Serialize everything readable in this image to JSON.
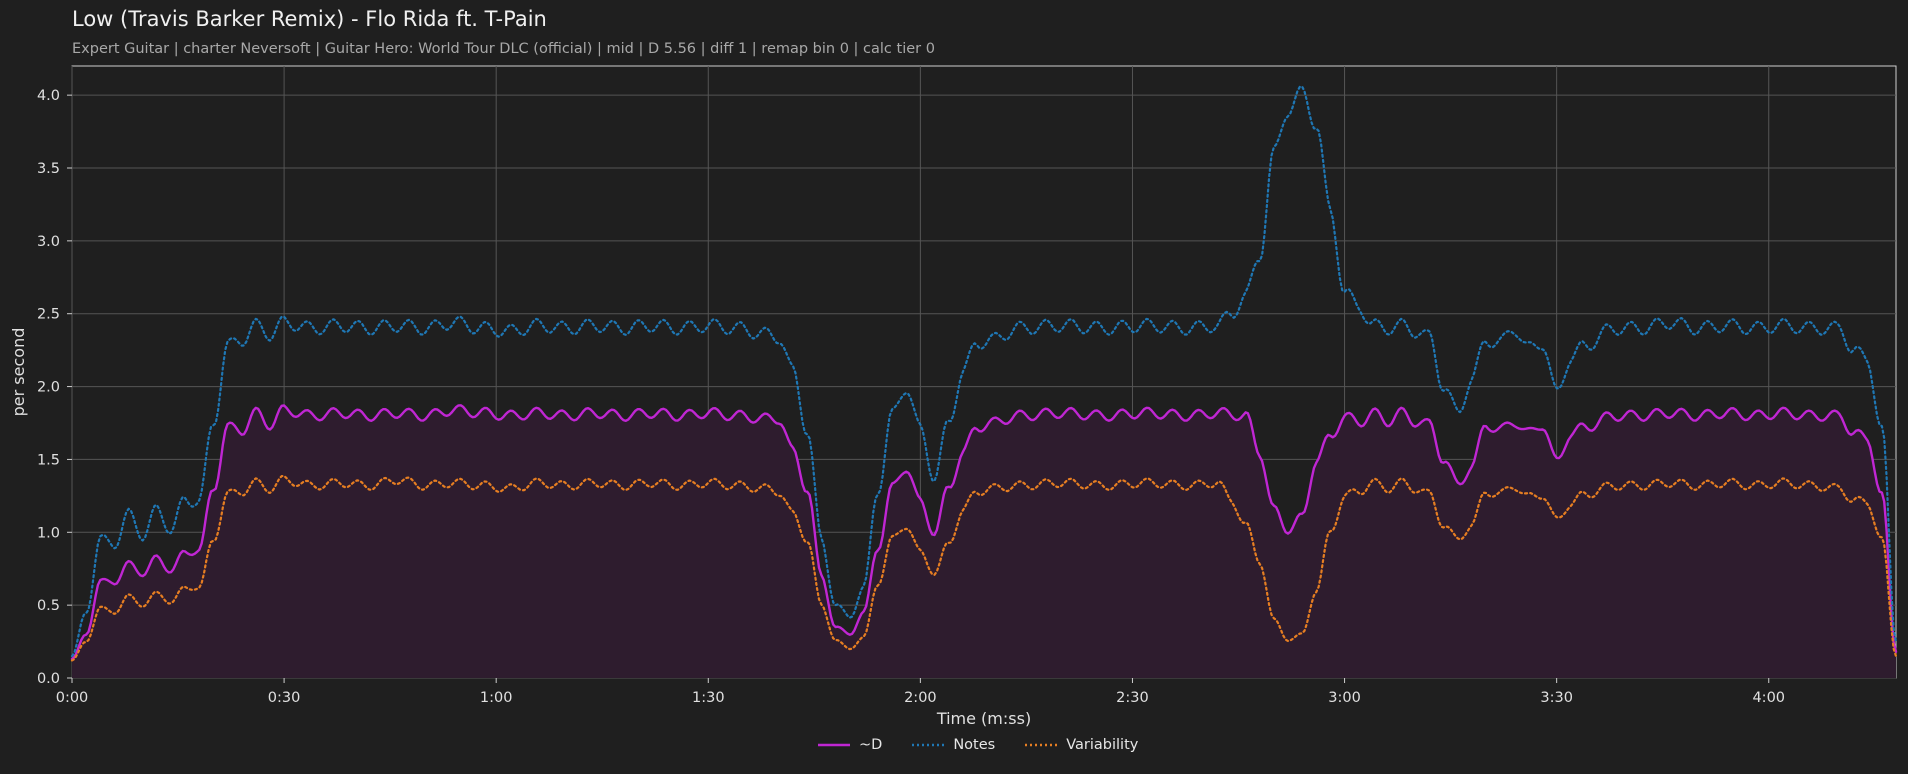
{
  "header": {
    "title": "Low (Travis Barker Remix) - Flo Rida ft. T-Pain",
    "subtitle": "Expert Guitar  |  charter Neversoft  |  Guitar Hero: World Tour DLC (official)  |  mid  |  D 5.56  |  diff 1  |  remap bin 0  |  calc tier 0"
  },
  "colors": {
    "background": "#1f1f1f",
    "d": "#c026d3",
    "notes": "#1f77b4",
    "variability": "#e67e22",
    "area_fill": "#2e1c2e",
    "grid": "#555555"
  },
  "chart_data": {
    "type": "line",
    "xlabel": "Time (m:ss)",
    "ylabel": "per second",
    "xlim": [
      0,
      258
    ],
    "ylim": [
      0,
      4.2
    ],
    "x_ticks": [
      {
        "value": 0,
        "label": "0:00"
      },
      {
        "value": 30,
        "label": "0:30"
      },
      {
        "value": 60,
        "label": "1:00"
      },
      {
        "value": 90,
        "label": "1:30"
      },
      {
        "value": 120,
        "label": "2:00"
      },
      {
        "value": 150,
        "label": "2:30"
      },
      {
        "value": 180,
        "label": "3:00"
      },
      {
        "value": 210,
        "label": "3:30"
      },
      {
        "value": 240,
        "label": "4:00"
      }
    ],
    "y_ticks": [
      {
        "value": 0,
        "label": "0.0"
      },
      {
        "value": 0.5,
        "label": "0.5"
      },
      {
        "value": 1.0,
        "label": "1.0"
      },
      {
        "value": 1.5,
        "label": "1.5"
      },
      {
        "value": 2.0,
        "label": "2.0"
      },
      {
        "value": 2.5,
        "label": "2.5"
      },
      {
        "value": 3.0,
        "label": "3.0"
      },
      {
        "value": 3.5,
        "label": "3.5"
      },
      {
        "value": 4.0,
        "label": "4.0"
      }
    ],
    "grid": true,
    "legend_position": "bottom-center",
    "series": [
      {
        "name": "~D",
        "style": "solid",
        "filled": true,
        "points": [
          [
            0,
            0.13
          ],
          [
            2,
            0.3
          ],
          [
            4,
            0.66
          ],
          [
            6,
            0.66
          ],
          [
            8,
            0.78
          ],
          [
            10,
            0.72
          ],
          [
            12,
            0.82
          ],
          [
            14,
            0.74
          ],
          [
            16,
            0.86
          ],
          [
            18,
            0.88
          ],
          [
            20,
            1.3
          ],
          [
            22,
            1.72
          ],
          [
            24,
            1.7
          ],
          [
            26,
            1.82
          ],
          [
            28,
            1.74
          ],
          [
            30,
            1.84
          ],
          [
            34,
            1.8
          ],
          [
            38,
            1.82
          ],
          [
            42,
            1.8
          ],
          [
            46,
            1.82
          ],
          [
            50,
            1.8
          ],
          [
            54,
            1.84
          ],
          [
            58,
            1.82
          ],
          [
            62,
            1.8
          ],
          [
            66,
            1.82
          ],
          [
            70,
            1.8
          ],
          [
            74,
            1.82
          ],
          [
            78,
            1.8
          ],
          [
            82,
            1.82
          ],
          [
            86,
            1.8
          ],
          [
            90,
            1.82
          ],
          [
            94,
            1.8
          ],
          [
            98,
            1.78
          ],
          [
            100,
            1.78
          ],
          [
            102,
            1.55
          ],
          [
            104,
            1.3
          ],
          [
            106,
            0.7
          ],
          [
            108,
            0.35
          ],
          [
            110,
            0.3
          ],
          [
            112,
            0.45
          ],
          [
            114,
            0.9
          ],
          [
            116,
            1.3
          ],
          [
            118,
            1.45
          ],
          [
            120,
            1.2
          ],
          [
            122,
            1.0
          ],
          [
            124,
            1.3
          ],
          [
            126,
            1.55
          ],
          [
            128,
            1.72
          ],
          [
            130,
            1.75
          ],
          [
            134,
            1.8
          ],
          [
            140,
            1.82
          ],
          [
            146,
            1.8
          ],
          [
            152,
            1.82
          ],
          [
            158,
            1.8
          ],
          [
            162,
            1.82
          ],
          [
            166,
            1.8
          ],
          [
            168,
            1.55
          ],
          [
            170,
            1.15
          ],
          [
            172,
            1.02
          ],
          [
            174,
            1.1
          ],
          [
            176,
            1.5
          ],
          [
            178,
            1.65
          ],
          [
            180,
            1.8
          ],
          [
            182,
            1.75
          ],
          [
            184,
            1.82
          ],
          [
            186,
            1.76
          ],
          [
            188,
            1.82
          ],
          [
            190,
            1.76
          ],
          [
            192,
            1.74
          ],
          [
            194,
            1.5
          ],
          [
            196,
            1.33
          ],
          [
            198,
            1.45
          ],
          [
            200,
            1.74
          ],
          [
            202,
            1.7
          ],
          [
            204,
            1.76
          ],
          [
            206,
            1.68
          ],
          [
            208,
            1.74
          ],
          [
            210,
            1.48
          ],
          [
            212,
            1.68
          ],
          [
            214,
            1.72
          ],
          [
            218,
            1.8
          ],
          [
            222,
            1.8
          ],
          [
            226,
            1.82
          ],
          [
            230,
            1.8
          ],
          [
            234,
            1.82
          ],
          [
            238,
            1.8
          ],
          [
            242,
            1.82
          ],
          [
            246,
            1.8
          ],
          [
            250,
            1.8
          ],
          [
            252,
            1.68
          ],
          [
            254,
            1.64
          ],
          [
            256,
            1.25
          ],
          [
            258,
            0.18
          ]
        ]
      },
      {
        "name": "Notes",
        "style": "dotted",
        "filled": false,
        "points": [
          [
            0,
            0.15
          ],
          [
            2,
            0.45
          ],
          [
            4,
            0.95
          ],
          [
            6,
            0.92
          ],
          [
            8,
            1.12
          ],
          [
            10,
            0.98
          ],
          [
            12,
            1.15
          ],
          [
            14,
            1.02
          ],
          [
            16,
            1.22
          ],
          [
            18,
            1.22
          ],
          [
            20,
            1.75
          ],
          [
            22,
            2.28
          ],
          [
            24,
            2.32
          ],
          [
            26,
            2.42
          ],
          [
            28,
            2.36
          ],
          [
            30,
            2.44
          ],
          [
            34,
            2.4
          ],
          [
            38,
            2.42
          ],
          [
            42,
            2.4
          ],
          [
            46,
            2.42
          ],
          [
            50,
            2.4
          ],
          [
            54,
            2.44
          ],
          [
            58,
            2.4
          ],
          [
            62,
            2.38
          ],
          [
            66,
            2.42
          ],
          [
            70,
            2.4
          ],
          [
            74,
            2.42
          ],
          [
            78,
            2.4
          ],
          [
            82,
            2.42
          ],
          [
            86,
            2.4
          ],
          [
            90,
            2.42
          ],
          [
            94,
            2.4
          ],
          [
            98,
            2.36
          ],
          [
            100,
            2.34
          ],
          [
            102,
            2.1
          ],
          [
            104,
            1.7
          ],
          [
            106,
            0.95
          ],
          [
            108,
            0.5
          ],
          [
            110,
            0.42
          ],
          [
            112,
            0.62
          ],
          [
            114,
            1.3
          ],
          [
            116,
            1.8
          ],
          [
            118,
            2.0
          ],
          [
            120,
            1.7
          ],
          [
            122,
            1.38
          ],
          [
            124,
            1.75
          ],
          [
            126,
            2.1
          ],
          [
            128,
            2.3
          ],
          [
            130,
            2.32
          ],
          [
            134,
            2.4
          ],
          [
            140,
            2.42
          ],
          [
            146,
            2.4
          ],
          [
            152,
            2.42
          ],
          [
            158,
            2.4
          ],
          [
            162,
            2.42
          ],
          [
            164,
            2.5
          ],
          [
            166,
            2.62
          ],
          [
            168,
            2.9
          ],
          [
            170,
            3.6
          ],
          [
            172,
            3.9
          ],
          [
            174,
            4.02
          ],
          [
            176,
            3.8
          ],
          [
            178,
            3.2
          ],
          [
            180,
            2.65
          ],
          [
            182,
            2.55
          ],
          [
            184,
            2.42
          ],
          [
            186,
            2.4
          ],
          [
            188,
            2.42
          ],
          [
            190,
            2.38
          ],
          [
            192,
            2.34
          ],
          [
            194,
            2.0
          ],
          [
            196,
            1.82
          ],
          [
            198,
            2.05
          ],
          [
            200,
            2.32
          ],
          [
            202,
            2.3
          ],
          [
            204,
            2.4
          ],
          [
            206,
            2.26
          ],
          [
            208,
            2.3
          ],
          [
            210,
            1.95
          ],
          [
            212,
            2.2
          ],
          [
            214,
            2.28
          ],
          [
            218,
            2.4
          ],
          [
            222,
            2.4
          ],
          [
            226,
            2.44
          ],
          [
            230,
            2.4
          ],
          [
            234,
            2.42
          ],
          [
            238,
            2.4
          ],
          [
            242,
            2.42
          ],
          [
            246,
            2.4
          ],
          [
            250,
            2.4
          ],
          [
            252,
            2.25
          ],
          [
            254,
            2.18
          ],
          [
            256,
            1.7
          ],
          [
            258,
            0.25
          ]
        ]
      },
      {
        "name": "Variability",
        "style": "dotted",
        "filled": false,
        "points": [
          [
            0,
            0.12
          ],
          [
            2,
            0.25
          ],
          [
            4,
            0.48
          ],
          [
            6,
            0.45
          ],
          [
            8,
            0.56
          ],
          [
            10,
            0.5
          ],
          [
            12,
            0.58
          ],
          [
            14,
            0.52
          ],
          [
            16,
            0.62
          ],
          [
            18,
            0.62
          ],
          [
            20,
            0.95
          ],
          [
            22,
            1.26
          ],
          [
            24,
            1.28
          ],
          [
            26,
            1.34
          ],
          [
            28,
            1.3
          ],
          [
            30,
            1.36
          ],
          [
            34,
            1.32
          ],
          [
            38,
            1.34
          ],
          [
            42,
            1.32
          ],
          [
            46,
            1.36
          ],
          [
            50,
            1.32
          ],
          [
            54,
            1.34
          ],
          [
            58,
            1.32
          ],
          [
            62,
            1.3
          ],
          [
            66,
            1.34
          ],
          [
            70,
            1.32
          ],
          [
            74,
            1.34
          ],
          [
            78,
            1.32
          ],
          [
            82,
            1.34
          ],
          [
            86,
            1.32
          ],
          [
            90,
            1.34
          ],
          [
            94,
            1.32
          ],
          [
            98,
            1.3
          ],
          [
            100,
            1.28
          ],
          [
            102,
            1.12
          ],
          [
            104,
            0.95
          ],
          [
            106,
            0.5
          ],
          [
            108,
            0.26
          ],
          [
            110,
            0.2
          ],
          [
            112,
            0.28
          ],
          [
            114,
            0.65
          ],
          [
            116,
            0.95
          ],
          [
            118,
            1.05
          ],
          [
            120,
            0.86
          ],
          [
            122,
            0.72
          ],
          [
            124,
            0.92
          ],
          [
            126,
            1.15
          ],
          [
            128,
            1.28
          ],
          [
            130,
            1.3
          ],
          [
            134,
            1.32
          ],
          [
            140,
            1.34
          ],
          [
            146,
            1.32
          ],
          [
            152,
            1.34
          ],
          [
            158,
            1.32
          ],
          [
            162,
            1.34
          ],
          [
            164,
            1.22
          ],
          [
            166,
            1.05
          ],
          [
            168,
            0.8
          ],
          [
            170,
            0.4
          ],
          [
            172,
            0.26
          ],
          [
            174,
            0.3
          ],
          [
            176,
            0.6
          ],
          [
            178,
            1.0
          ],
          [
            180,
            1.25
          ],
          [
            182,
            1.28
          ],
          [
            184,
            1.34
          ],
          [
            186,
            1.3
          ],
          [
            188,
            1.34
          ],
          [
            190,
            1.3
          ],
          [
            192,
            1.26
          ],
          [
            194,
            1.05
          ],
          [
            196,
            0.95
          ],
          [
            198,
            1.05
          ],
          [
            200,
            1.28
          ],
          [
            202,
            1.26
          ],
          [
            204,
            1.32
          ],
          [
            206,
            1.24
          ],
          [
            208,
            1.26
          ],
          [
            210,
            1.08
          ],
          [
            212,
            1.2
          ],
          [
            214,
            1.26
          ],
          [
            218,
            1.32
          ],
          [
            222,
            1.32
          ],
          [
            226,
            1.34
          ],
          [
            230,
            1.32
          ],
          [
            234,
            1.34
          ],
          [
            238,
            1.32
          ],
          [
            242,
            1.34
          ],
          [
            246,
            1.32
          ],
          [
            250,
            1.3
          ],
          [
            252,
            1.22
          ],
          [
            254,
            1.2
          ],
          [
            256,
            0.95
          ],
          [
            258,
            0.15
          ]
        ]
      }
    ]
  }
}
